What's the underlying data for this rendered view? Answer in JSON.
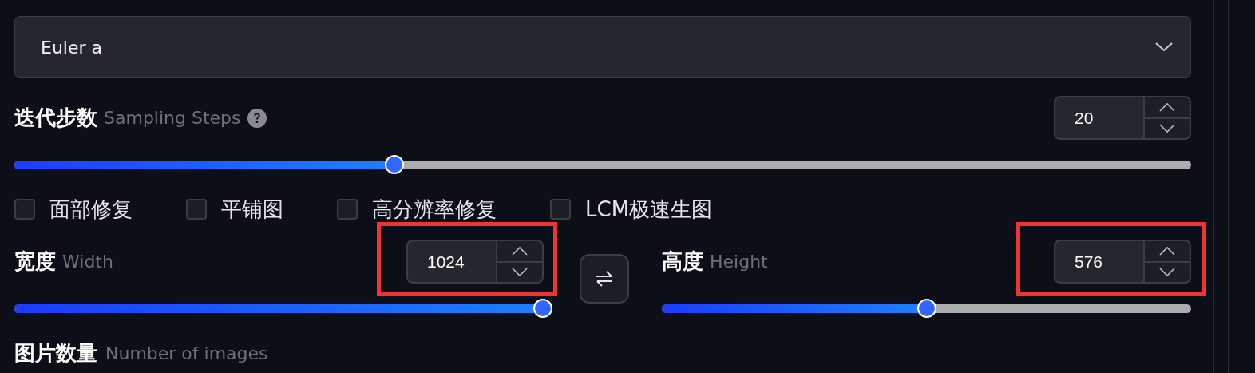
{
  "sampler": {
    "value": "Euler a"
  },
  "steps": {
    "label": "迭代步数",
    "sublabel": "Sampling Steps",
    "value": "20",
    "level": 0.32
  },
  "options": [
    {
      "label": "面部修复",
      "checked": false
    },
    {
      "label": "平铺图",
      "checked": false
    },
    {
      "label": "高分辨率修复",
      "checked": false
    },
    {
      "label": "LCM极速生图",
      "checked": false
    }
  ],
  "width": {
    "label": "宽度",
    "sublabel": "Width",
    "value": "1024",
    "level": 1.0,
    "highlighted": true
  },
  "height": {
    "label": "高度",
    "sublabel": "Height",
    "value": "576",
    "level": 0.5,
    "highlighted": true
  },
  "images": {
    "label": "图片数量",
    "sublabel": "Number of images"
  }
}
